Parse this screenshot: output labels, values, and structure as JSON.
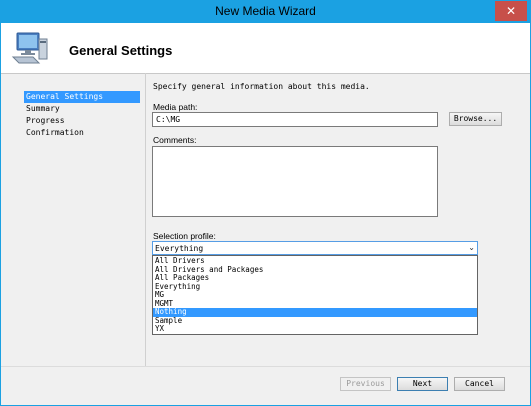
{
  "window": {
    "title": "New Media Wizard",
    "close_glyph": "✕"
  },
  "header": {
    "title": "General Settings",
    "icon": "computer-icon"
  },
  "nav": {
    "items": [
      {
        "label": "General Settings",
        "selected": true
      },
      {
        "label": "Summary",
        "selected": false
      },
      {
        "label": "Progress",
        "selected": false
      },
      {
        "label": "Confirmation",
        "selected": false
      }
    ]
  },
  "main": {
    "description": "Specify general information about this media.",
    "media_path_label": "Media path:",
    "media_path_value": "C:\\MG",
    "browse_label": "Browse...",
    "comments_label": "Comments:",
    "comments_value": "",
    "selection_profile_label": "Selection profile:",
    "selection_profile_value": "Everything",
    "profile_options": [
      {
        "label": "All Drivers",
        "selected": false
      },
      {
        "label": "All Drivers and Packages",
        "selected": false
      },
      {
        "label": "All Packages",
        "selected": false
      },
      {
        "label": "Everything",
        "selected": false
      },
      {
        "label": "MG",
        "selected": false
      },
      {
        "label": "MGMT",
        "selected": false
      },
      {
        "label": "Nothing",
        "selected": true
      },
      {
        "label": "Sample",
        "selected": false
      },
      {
        "label": "YX",
        "selected": false
      }
    ]
  },
  "footer": {
    "previous_label": "Previous",
    "next_label": "Next",
    "cancel_label": "Cancel"
  }
}
